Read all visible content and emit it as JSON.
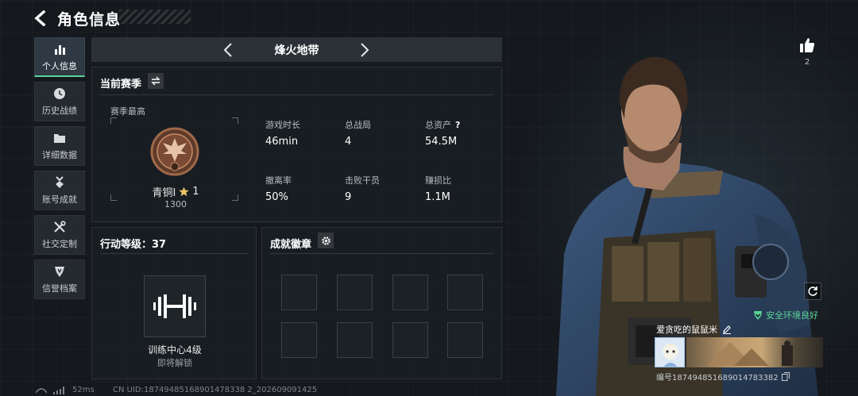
{
  "header": {
    "title": "角色信息"
  },
  "sidebar": {
    "items": [
      {
        "label": "个人信息",
        "icon": "bar-chart-icon",
        "active": true
      },
      {
        "label": "历史战绩",
        "icon": "clock-icon"
      },
      {
        "label": "详细数据",
        "icon": "folder-icon"
      },
      {
        "label": "账号成就",
        "icon": "medal-icon"
      },
      {
        "label": "社交定制",
        "icon": "tools-icon"
      },
      {
        "label": "信誉档案",
        "icon": "shield-icon"
      }
    ]
  },
  "map_selector": {
    "name": "烽火地带"
  },
  "season": {
    "title": "当前赛季",
    "subtitle": "赛季最高",
    "rank_name": "青铜I",
    "rank_stars": "1",
    "rank_score": "1300",
    "stats": [
      {
        "label": "游戏时长",
        "value": "46min"
      },
      {
        "label": "总战局",
        "value": "4"
      },
      {
        "label": "总资产",
        "value": "54.5M",
        "help": "?"
      },
      {
        "label": "撤离率",
        "value": "50%"
      },
      {
        "label": "击败干员",
        "value": "9"
      },
      {
        "label": "赚损比",
        "value": "1.1M"
      }
    ]
  },
  "action_level": {
    "title": "行动等级：37",
    "trainer_name": "训练中心4级",
    "trainer_status": "即将解锁"
  },
  "badges": {
    "title": "成就徽章"
  },
  "profile": {
    "likes": "2",
    "safe_status": "安全环境良好",
    "player_name": "爱贪吃的鼠鼠米",
    "player_id": "编号18749485168901478338​2"
  },
  "status_bar": {
    "ping": "52ms",
    "uid": "CN UID:18749485168901478338 2_202609091425"
  },
  "colors": {
    "accent": "#5ad39a",
    "bronze": "#a0694a"
  }
}
